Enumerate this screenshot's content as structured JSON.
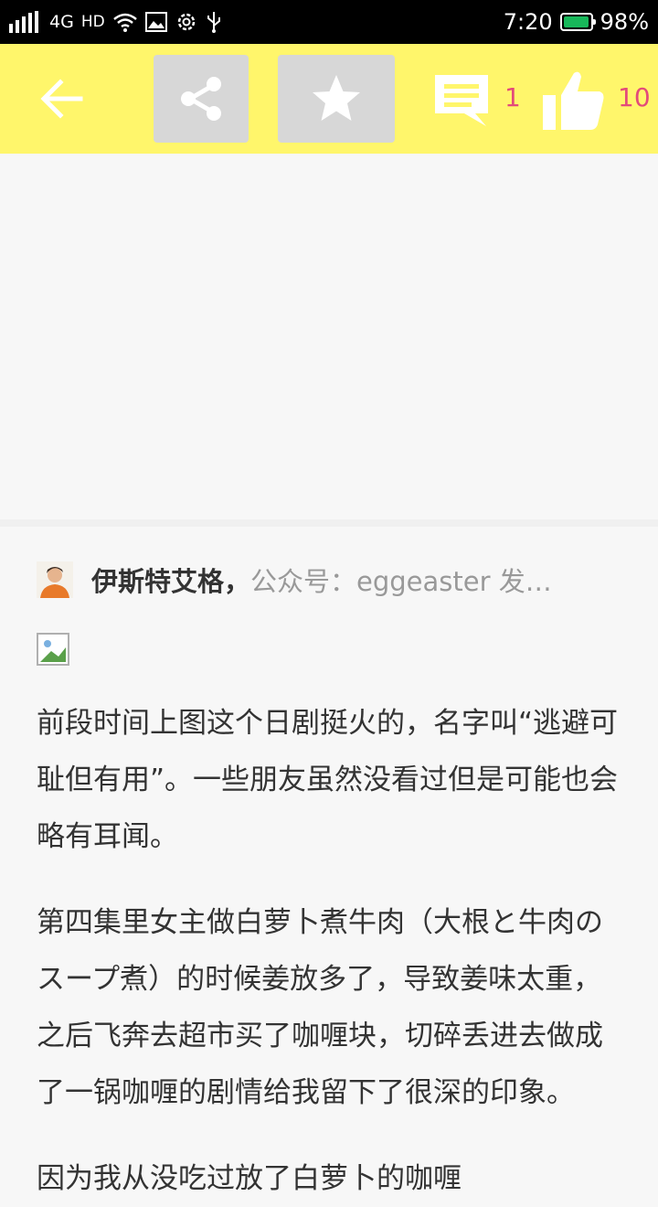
{
  "status_bar": {
    "network": "4G",
    "hd": "HD",
    "time": "7:20",
    "battery_percent": "98%",
    "battery_level": 0.98
  },
  "toolbar": {
    "comment_count": "1",
    "like_count": "10",
    "icons": [
      "back-arrow-icon",
      "share-icon",
      "star-icon",
      "comment-icon",
      "thumbs-up-icon"
    ],
    "background_color": "#fff66b",
    "count_color": "#e34b7a"
  },
  "article": {
    "author_name": "伊斯特艾格，",
    "author_meta": "公众号：eggeaster 发…",
    "paragraphs": [
      "前段时间上图这个日剧挺火的，名字叫“逃避可耻但有用”。一些朋友虽然没看过但是可能也会略有耳闻。",
      "第四集里女主做白萝卜煮牛肉（大根と牛肉のスープ煮）的时候姜放多了，导致姜味太重，之后飞奔去超市买了咖喱块，切碎丢进去做成了一锅咖喱的剧情给我留下了很深的印象。",
      "因为我从没吃过放了白萝卜的咖喱"
    ]
  }
}
